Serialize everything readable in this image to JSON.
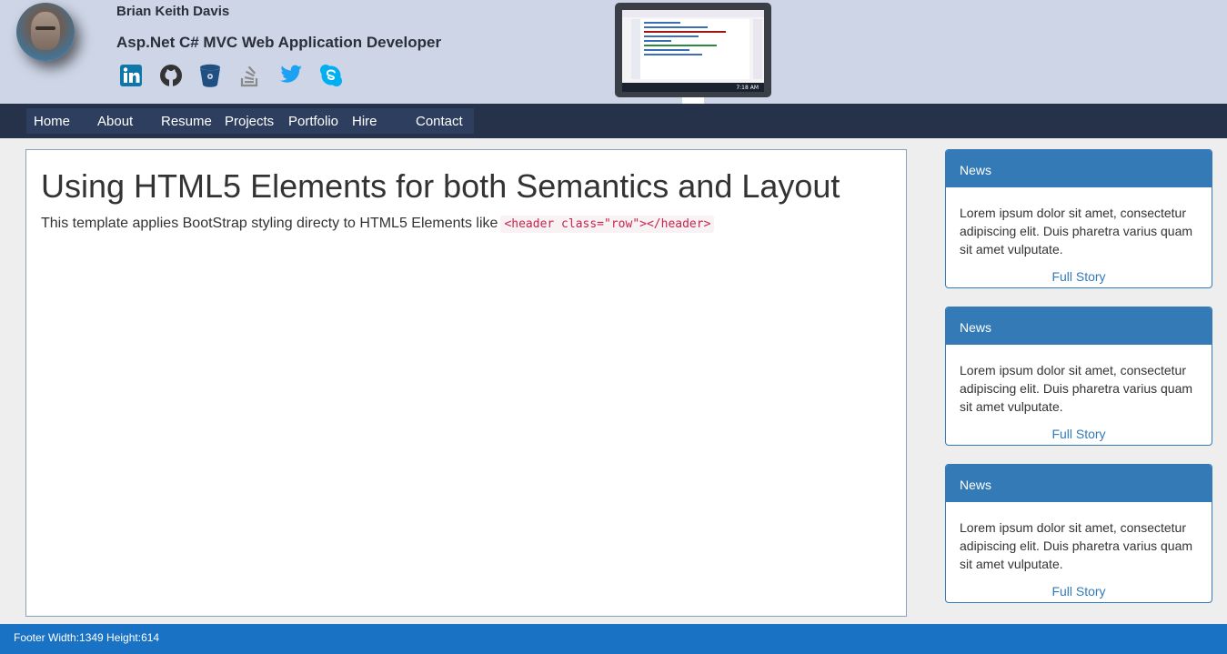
{
  "header": {
    "name": "Brian Keith Davis",
    "role": "Asp.Net C# MVC Web Application Developer",
    "socials": [
      {
        "icon": "linkedin-icon",
        "color": "#0e76a8"
      },
      {
        "icon": "github-icon",
        "color": "#333333"
      },
      {
        "icon": "bitbucket-icon",
        "color": "#205081"
      },
      {
        "icon": "stackoverflow-icon",
        "color": "#8a8a8a"
      },
      {
        "icon": "twitter-icon",
        "color": "#1da1f2"
      },
      {
        "icon": "skype-icon",
        "color": "#00aff0"
      }
    ],
    "monitor_clock": "7:18 AM"
  },
  "nav": {
    "items": [
      "Home",
      "About",
      "Resume",
      "Projects",
      "Portfolio",
      "Hire",
      "Contact"
    ]
  },
  "main": {
    "title": "Using HTML5 Elements for both Semantics and Layout",
    "text": "This template applies BootStrap styling directy to HTML5 Elements like",
    "code": "<header class=\"row\"></header>"
  },
  "panels": [
    {
      "heading": "News",
      "body": "Lorem ipsum dolor sit amet, consectetur adipiscing elit. Duis pharetra varius quam sit amet vulputate.",
      "link": "Full Story"
    },
    {
      "heading": "News",
      "body": "Lorem ipsum dolor sit amet, consectetur adipiscing elit. Duis pharetra varius quam sit amet vulputate.",
      "link": "Full Story"
    },
    {
      "heading": "News",
      "body": "Lorem ipsum dolor sit amet, consectetur adipiscing elit. Duis pharetra varius quam sit amet vulputate.",
      "link": "Full Story"
    }
  ],
  "footer": {
    "text": "Footer Width:1349 Height:614"
  },
  "colors": {
    "header_bg": "#cdd5e6",
    "navbar_bg": "#26324a",
    "panel_accent": "#337ab7",
    "footer_bg": "#1a72c4"
  }
}
